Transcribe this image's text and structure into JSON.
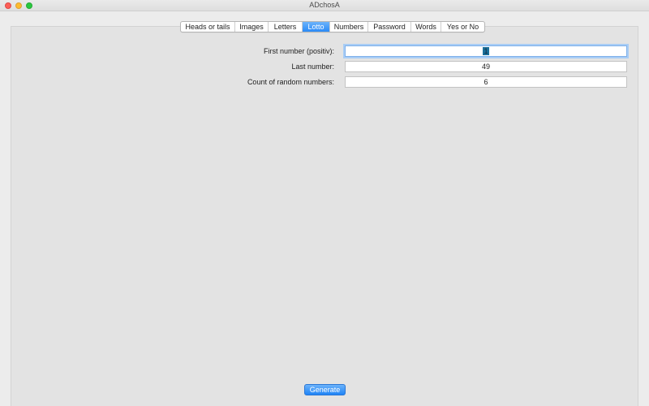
{
  "window": {
    "title": "ADchosA"
  },
  "tabs": [
    {
      "label": "Heads or tails",
      "active": false
    },
    {
      "label": "Images",
      "active": false
    },
    {
      "label": "Letters",
      "active": false
    },
    {
      "label": "Lotto",
      "active": true
    },
    {
      "label": "Numbers",
      "active": false
    },
    {
      "label": "Password",
      "active": false
    },
    {
      "label": "Words",
      "active": false
    },
    {
      "label": "Yes or No",
      "active": false
    }
  ],
  "form": {
    "first_number": {
      "label": "First number (positiv):",
      "value": "1"
    },
    "last_number": {
      "label": "Last number:",
      "value": "49"
    },
    "count": {
      "label": "Count of random numbers:",
      "value": "6"
    }
  },
  "actions": {
    "generate_label": "Generate"
  },
  "colors": {
    "accent": "#2a8af7",
    "focus_ring": "#a9cdf5",
    "panel": "#e3e3e3",
    "window": "#ececec"
  }
}
